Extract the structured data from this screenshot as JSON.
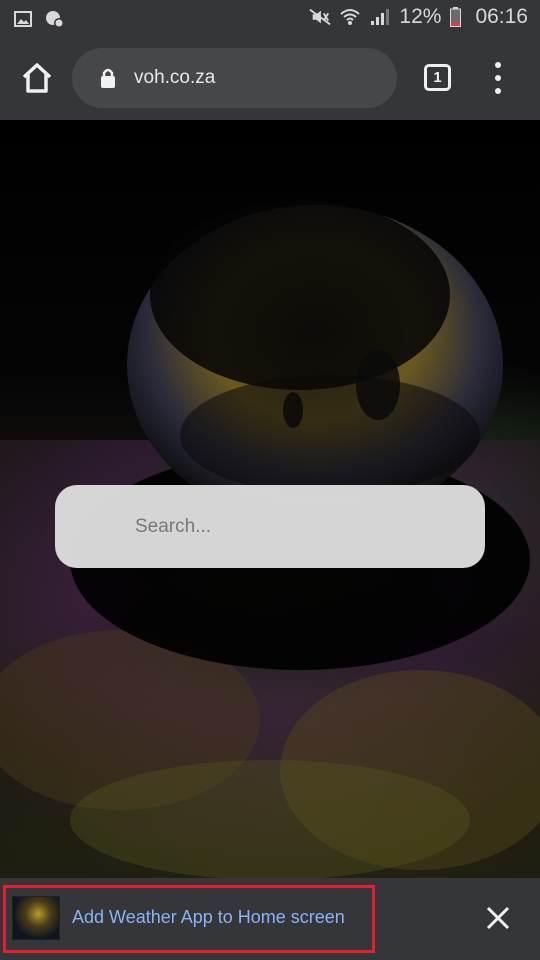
{
  "status_bar": {
    "battery_percent": "12%",
    "time": "06:16",
    "icons": [
      "image-icon",
      "settings-badge-icon",
      "mute-icon",
      "wifi-icon",
      "signal-icon",
      "battery-icon"
    ]
  },
  "toolbar": {
    "url": "voh.co.za",
    "tab_count": "1"
  },
  "page": {
    "search_placeholder": "Search..."
  },
  "banner": {
    "text": "Add Weather App to Home screen",
    "highlight_color": "#e3202b"
  },
  "colors": {
    "chrome": "#353639",
    "omnibox": "#46474a",
    "link": "#8ab4f8"
  }
}
